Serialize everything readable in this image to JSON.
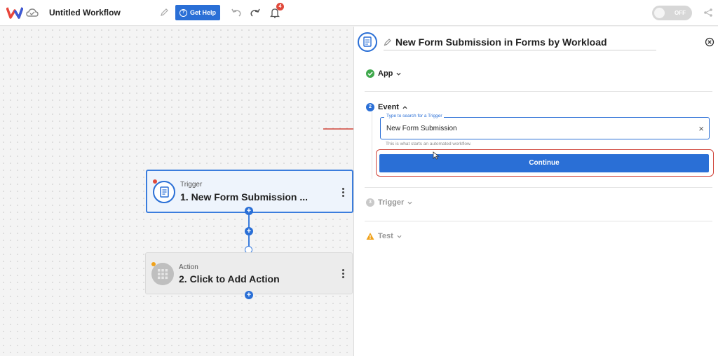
{
  "topbar": {
    "workflow_title": "Untitled Workflow",
    "help_label": "Get Help",
    "notification_count": "4",
    "toggle_label": "OFF"
  },
  "canvas": {
    "trigger_node": {
      "subtitle": "Trigger",
      "title": "1. New Form Submission ..."
    },
    "action_node": {
      "subtitle": "Action",
      "title": "2. Click to Add Action"
    },
    "plus_symbol": "+"
  },
  "panel": {
    "title": "New Form Submission in Forms by Workload",
    "steps": {
      "app": {
        "label": "App"
      },
      "event": {
        "number": "2",
        "label": "Event"
      },
      "trigger": {
        "number": "3",
        "label": "Trigger"
      },
      "test": {
        "label": "Test"
      }
    },
    "search": {
      "legend": "Type to search for a Trigger",
      "value": "New Form Submission",
      "clear": "×"
    },
    "hint": "This is what starts an automated workflow.",
    "continue_label": "Continue"
  },
  "colors": {
    "accent": "#2a6fd6",
    "success": "#3fa84c",
    "warning": "#f0a21b",
    "highlight": "#d0443a"
  },
  "icons": [
    "workload-logo-icon",
    "cloud-icon",
    "pencil-icon",
    "help-icon",
    "undo-icon",
    "redo-icon",
    "bell-icon",
    "share-icon",
    "form-icon",
    "grid-apps-icon",
    "close-icon",
    "check-icon",
    "chevron-down-icon",
    "chevron-up-icon",
    "warning-icon",
    "cursor-icon",
    "arrow-icon"
  ]
}
